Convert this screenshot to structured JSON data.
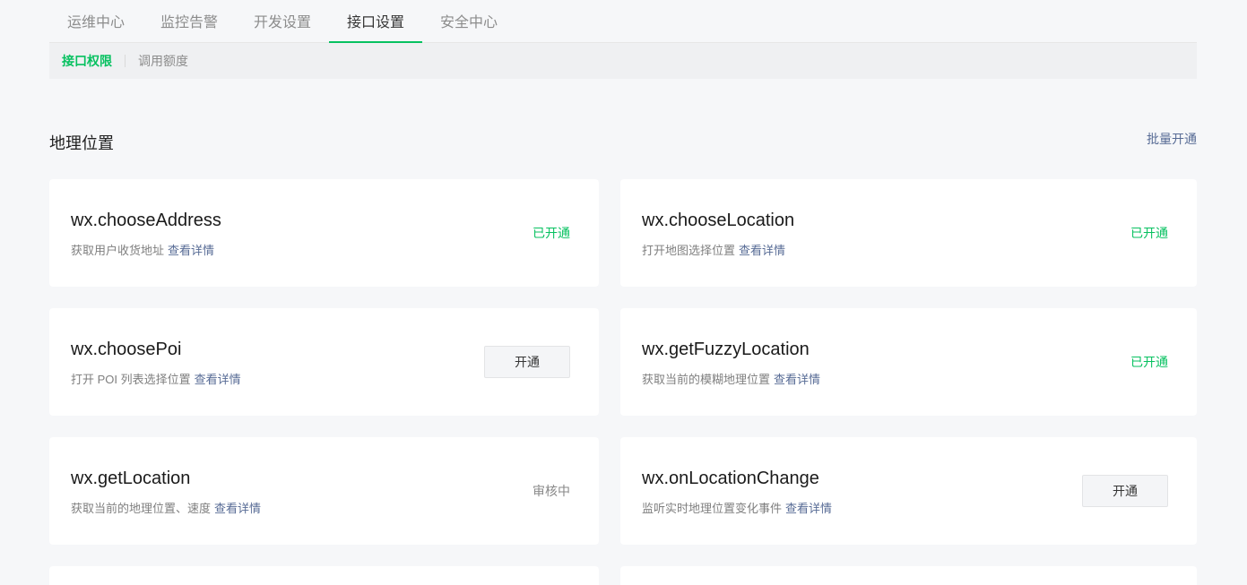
{
  "theme": {
    "accent": "#07c160",
    "link": "#576b95",
    "muted": "#888888"
  },
  "top_tabs": [
    {
      "label": "运维中心",
      "active": false
    },
    {
      "label": "监控告警",
      "active": false
    },
    {
      "label": "开发设置",
      "active": false
    },
    {
      "label": "接口设置",
      "active": true
    },
    {
      "label": "安全中心",
      "active": false
    }
  ],
  "sub_tabs": [
    {
      "label": "接口权限",
      "active": true
    },
    {
      "label": "调用额度",
      "active": false
    }
  ],
  "section": {
    "title": "地理位置",
    "batch_action": "批量开通"
  },
  "apis": [
    {
      "name": "wx.chooseAddress",
      "description": "获取用户收货地址",
      "link": "查看详情",
      "status": "已开通",
      "status_color": "#07c160"
    },
    {
      "name": "wx.chooseLocation",
      "description": "打开地图选择位置",
      "link": "查看详情",
      "status": "已开通",
      "status_color": "#07c160"
    },
    {
      "name": "wx.choosePoi",
      "description": "打开 POI 列表选择位置",
      "link": "查看详情",
      "button": "开通"
    },
    {
      "name": "wx.getFuzzyLocation",
      "description": "获取当前的模糊地理位置",
      "link": "查看详情",
      "status": "已开通",
      "status_color": "#07c160"
    },
    {
      "name": "wx.getLocation",
      "description": "获取当前的地理位置、速度",
      "link": "查看详情",
      "status": "审核中",
      "status_color": "#888888"
    },
    {
      "name": "wx.onLocationChange",
      "description": "监听实时地理位置变化事件",
      "link": "查看详情",
      "button": "开通"
    }
  ]
}
